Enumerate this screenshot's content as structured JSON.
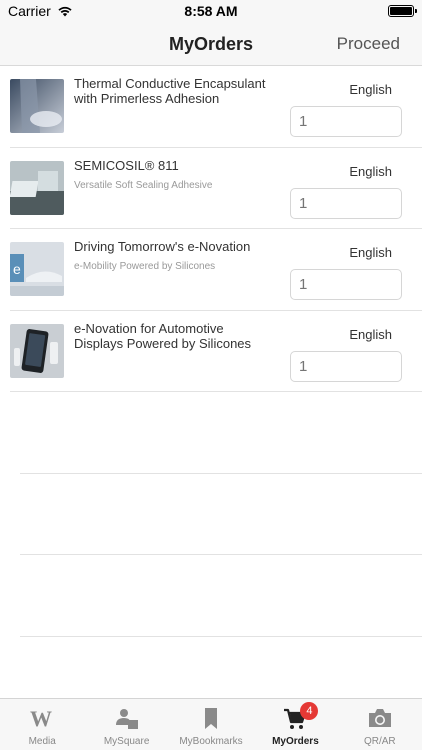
{
  "status_bar": {
    "carrier": "Carrier",
    "time": "8:58 AM"
  },
  "nav": {
    "title": "MyOrders",
    "proceed_label": "Proceed"
  },
  "orders": [
    {
      "title": "Thermal Conductive Encapsulant with Primerless Adhesion",
      "subtitle": "",
      "language": "English",
      "quantity_placeholder": "1"
    },
    {
      "title": "SEMICOSIL® 811",
      "subtitle": "Versatile Soft Sealing Adhesive",
      "language": "English",
      "quantity_placeholder": "1"
    },
    {
      "title": "Driving Tomorrow's e-Novation",
      "subtitle": "e-Mobility Powered by Silicones",
      "language": "English",
      "quantity_placeholder": "1"
    },
    {
      "title": "e-Novation for Automotive Displays Powered by Silicones",
      "subtitle": "",
      "language": "English",
      "quantity_placeholder": "1"
    }
  ],
  "tabs": [
    {
      "label": "Media",
      "icon": "wacker-logo-icon",
      "active": false
    },
    {
      "label": "MySquare",
      "icon": "user-square-icon",
      "active": false
    },
    {
      "label": "MyBookmarks",
      "icon": "bookmark-icon",
      "active": false
    },
    {
      "label": "MyOrders",
      "icon": "cart-icon",
      "active": true,
      "badge": "4"
    },
    {
      "label": "QR/AR",
      "icon": "camera-icon",
      "active": false
    }
  ],
  "colors": {
    "badge": "#e53935",
    "nav_background": "#f7f7f7",
    "active_tab": "#222222"
  }
}
